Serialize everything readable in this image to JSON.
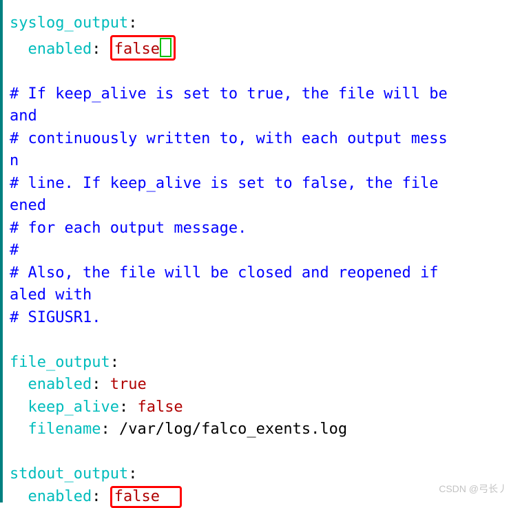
{
  "code": {
    "l01a": "syslog_output",
    "l01p": ":",
    "l02a": "  enabled",
    "l02p": ": ",
    "l02v": "false",
    "blank1": "",
    "c1": "# If keep_alive is set to true, the file will be",
    "c2": "and",
    "c3": "# continuously written to, with each output mess",
    "c4": "n",
    "c5": "# line. If keep_alive is set to false, the file ",
    "c6": "ened",
    "c7": "# for each output message.",
    "c8": "#",
    "c9": "# Also, the file will be closed and reopened if ",
    "c10": "aled with",
    "c11": "# SIGUSR1.",
    "blank2": "",
    "l14a": "file_output",
    "l14p": ":",
    "l15a": "  enabled",
    "l15p": ": ",
    "l15v": "true",
    "l16a": "  keep_alive",
    "l16p": ": ",
    "l16v": "false",
    "l17a": "  filename",
    "l17p": ": ",
    "l17v": "/var/log/falco_exents.log",
    "blank3": "",
    "l19a": "stdout_output",
    "l19p": ":",
    "l20a": "  enabled",
    "l20p": ": ",
    "l20v": "false"
  },
  "watermark": "CSDN @弓长丿"
}
